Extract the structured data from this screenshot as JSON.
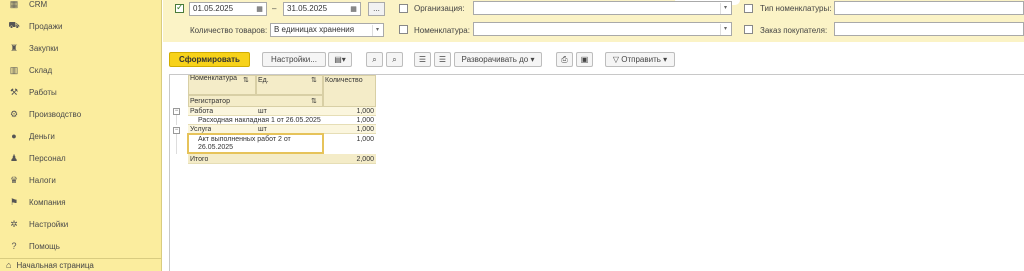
{
  "sidebar": {
    "items": [
      {
        "label": "CRM",
        "icon": "crm-icon",
        "glyph": "▦"
      },
      {
        "label": "Продажи",
        "icon": "sales-icon",
        "glyph": "⛟"
      },
      {
        "label": "Закупки",
        "icon": "purchases-icon",
        "glyph": "♜"
      },
      {
        "label": "Склад",
        "icon": "warehouse-icon",
        "glyph": "▥"
      },
      {
        "label": "Работы",
        "icon": "works-icon",
        "glyph": "⚒"
      },
      {
        "label": "Производство",
        "icon": "production-icon",
        "glyph": "⚙"
      },
      {
        "label": "Деньги",
        "icon": "money-icon",
        "glyph": "●"
      },
      {
        "label": "Персонал",
        "icon": "personnel-icon",
        "glyph": "♟"
      },
      {
        "label": "Налоги",
        "icon": "taxes-icon",
        "glyph": "♛"
      },
      {
        "label": "Компания",
        "icon": "company-icon",
        "glyph": "⚑"
      },
      {
        "label": "Настройки",
        "icon": "settings-icon",
        "glyph": "✲"
      },
      {
        "label": "Помощь",
        "icon": "help-icon",
        "glyph": "?"
      }
    ],
    "home_label": "Начальная страница"
  },
  "filters": {
    "period_from": "01.05.2025",
    "period_to": "31.05.2025",
    "dash": "–",
    "more_button": "...",
    "organization_label": "Организация:",
    "organization_value": "",
    "nomenclature_type_label": "Тип номенклатуры:",
    "quantity_label": "Количество товаров:",
    "quantity_value": "В единицах хранения",
    "nomenclature_label": "Номенклатура:",
    "nomenclature_value": "",
    "customer_order_label": "Заказ покупателя:"
  },
  "toolbar": {
    "generate_label": "Сформировать",
    "settings_label": "Настройки...",
    "expand_label": "Разворачивать до",
    "send_label": "Отправить"
  },
  "report": {
    "headers": {
      "nomenclature": "Номенклатура",
      "unit": "Ед.",
      "quantity": "Количество",
      "registrar": "Регистратор"
    },
    "rows": [
      {
        "name": "Работа",
        "unit": "шт",
        "qty": "1,000"
      },
      {
        "name": "Расходная накладная 1 от 26.05.2025",
        "unit": "",
        "qty": "1,000"
      },
      {
        "name": "Услуга",
        "unit": "шт",
        "qty": "1,000"
      },
      {
        "name_line1": "Акт выполненных работ 2 от",
        "name_line2": "26.05.2025",
        "unit": "",
        "qty": "1,000"
      }
    ],
    "total_label": "Итого",
    "total_qty": "2,000"
  }
}
